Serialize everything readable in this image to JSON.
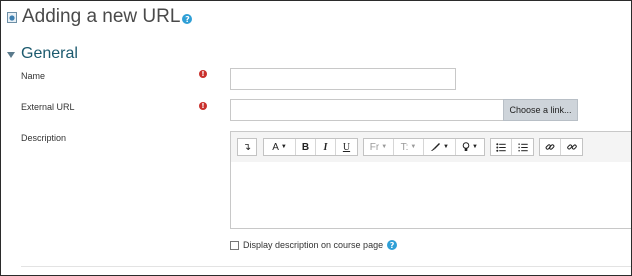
{
  "page": {
    "title": "Adding a new URL"
  },
  "section": {
    "title": "General"
  },
  "fields": {
    "name": {
      "label": "Name",
      "value": ""
    },
    "external_url": {
      "label": "External URL",
      "value": "",
      "button": "Choose a link..."
    },
    "description": {
      "label": "Description",
      "value": ""
    }
  },
  "toolbar": {
    "undo": "↴",
    "font": "A",
    "bold": "B",
    "italic": "I",
    "underline": "U",
    "font_family": "Fr",
    "font_size": "T:",
    "link": "🔗",
    "unlink": "⛓"
  },
  "checkbox": {
    "label": "Display description on course page",
    "checked": false
  },
  "colors": {
    "required": "#c9302c",
    "help": "#2f9fd6",
    "section": "#1c5a6e"
  }
}
